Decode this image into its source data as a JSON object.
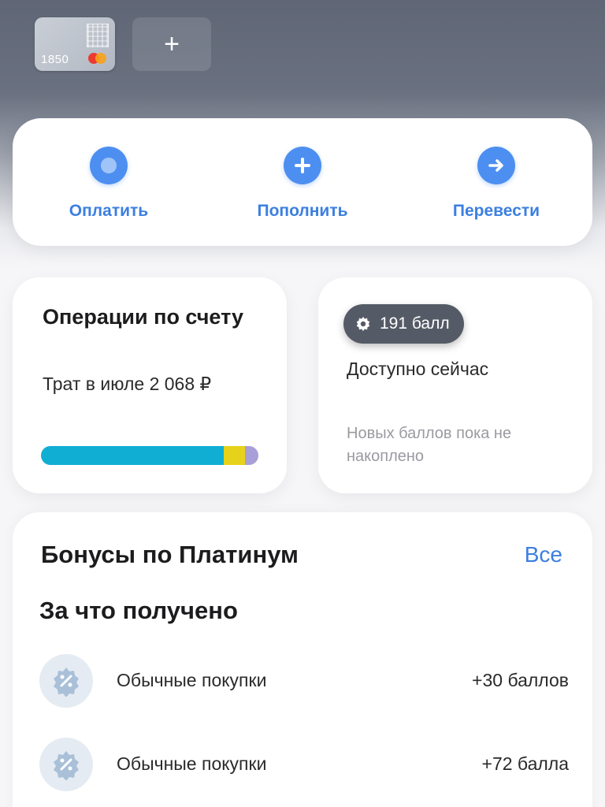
{
  "cards": {
    "card_last4": "1850",
    "add_label": "+"
  },
  "actions": [
    {
      "label": "Оплатить",
      "icon": "dot-icon"
    },
    {
      "label": "Пополнить",
      "icon": "plus-icon"
    },
    {
      "label": "Перевести",
      "icon": "arrow-right-icon"
    }
  ],
  "operations": {
    "title": "Операции по счету",
    "spent_text": "Трат в июле 2 068 ₽",
    "spending_breakdown": [
      {
        "share": 0.84,
        "color": "#11aed4"
      },
      {
        "share": 0.1,
        "color": "#e6d21a"
      },
      {
        "share": 0.06,
        "color": "#a89fd8"
      }
    ]
  },
  "points": {
    "badge": "191 балл",
    "available": "Доступно сейчас",
    "new_points": "Новых баллов пока не накоплено"
  },
  "bonuses": {
    "title": "Бонусы по Платинум",
    "all_link": "Все",
    "subtitle": "За что получено",
    "items": [
      {
        "name": "Обычные покупки",
        "amount": "+30 баллов"
      },
      {
        "name": "Обычные покупки",
        "amount": "+72 балла"
      }
    ]
  },
  "colors": {
    "accent": "#4d8ff0",
    "badge_bg": "#555b66"
  }
}
